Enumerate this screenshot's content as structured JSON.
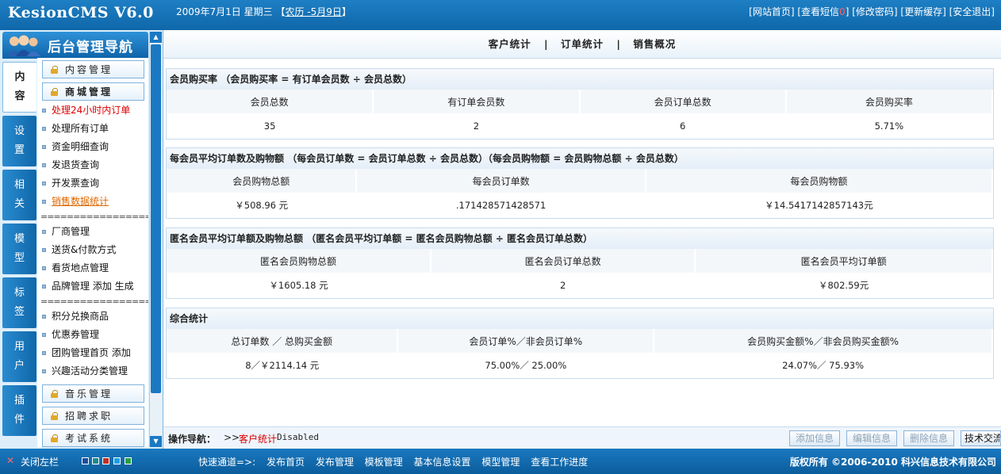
{
  "app": {
    "logo": "KesionCMS V6.0"
  },
  "header": {
    "date": "2009年7月1日 星期三",
    "lunar_open": "【",
    "lunar": "农历 -5月9日",
    "lunar_close": "】",
    "links": [
      {
        "label": "[网站首页]"
      },
      {
        "label": "[查看短信"
      },
      {
        "label": "]"
      },
      {
        "label": "[修改密码]"
      },
      {
        "label": "[更新缓存]"
      },
      {
        "label": "[安全退出]"
      }
    ],
    "msg_count": "0"
  },
  "sidebar": {
    "title": "后台管理导航",
    "tabs": [
      "内容",
      "设置",
      "相关",
      "模型",
      "标签",
      "用户",
      "插件"
    ],
    "sections": {
      "content": "内容管理",
      "mall": "商城管理",
      "music": "音乐管理",
      "jobs": "招聘求职",
      "exam": "考试系统"
    },
    "mall_items": [
      "处理24小时内订单",
      "处理所有订单",
      "资金明细查询",
      "发退货查询",
      "开发票查询",
      "销售数据统计"
    ],
    "separator": "==================",
    "group2": [
      "厂商管理",
      "送货&付款方式",
      "看货地点管理",
      "品牌管理 添加 生成"
    ],
    "group3": [
      "积分兑换商品",
      "优惠券管理",
      "团购管理首页 添加",
      "兴趣活动分类管理"
    ]
  },
  "tabs": [
    "客户统计",
    "订单统计",
    "销售概况"
  ],
  "tab_separator": "|",
  "panels": {
    "member": {
      "title": "会员购买率",
      "formula": "（会员购买率 = 有订单会员数 ÷ 会员总数）",
      "headers": [
        "会员总数",
        "有订单会员数",
        "会员订单总数",
        "会员购买率"
      ],
      "values": [
        "35",
        "2",
        "6",
        "5.71%"
      ]
    },
    "per_member": {
      "title": "每会员平均订单数及购物额",
      "formula": "（每会员订单数 = 会员订单总数 ÷ 会员总数）（每会员购物额 = 会员购物总额 ÷ 会员总数）",
      "headers": [
        "会员购物总额",
        "每会员订单数",
        "每会员购物额"
      ],
      "values": [
        "￥508.96 元",
        ".171428571428571",
        "￥14.5417142857143元"
      ]
    },
    "anon": {
      "title": "匿名会员平均订单额及购物总额",
      "formula": "（匿名会员平均订单额 = 匿名会员购物总额 ÷ 匿名会员订单总数）",
      "headers": [
        "匿名会员购物总额",
        "匿名会员订单总数",
        "匿名会员平均订单额"
      ],
      "values": [
        "￥1605.18 元",
        "2",
        "￥802.59元"
      ]
    },
    "summary": {
      "title": "综合统计",
      "headers": [
        "总订单数 ／ 总购买金额",
        "会员订单%／非会员订单%",
        "会员购买金额%／非会员购买金额%"
      ],
      "values": [
        "8／￥2114.14 元",
        "75.00%／ 25.00%",
        "24.07%／ 75.93%"
      ]
    }
  },
  "opbar": {
    "label": "操作导航：",
    "arrow": ">>",
    "current": "客户统计",
    "status": "Disabled",
    "buttons": [
      {
        "label": "添加信息",
        "enabled": false
      },
      {
        "label": "编辑信息",
        "enabled": false
      },
      {
        "label": "删除信息",
        "enabled": false
      },
      {
        "label": "技术交流",
        "enabled": true
      }
    ]
  },
  "footer": {
    "close_label": "关闭左栏",
    "swatches": [
      "#1a4fa0",
      "#1a8a8f",
      "#c03020",
      "#1aa0e0",
      "#2aa040"
    ],
    "quick_label": "快速通道=>:",
    "quick_links": [
      "发布首页",
      "发布管理",
      "模板管理",
      "基本信息设置",
      "模型管理",
      "查看工作进度"
    ],
    "copyright": "版权所有 ©2006-2010 科兴信息技术有限公司"
  }
}
